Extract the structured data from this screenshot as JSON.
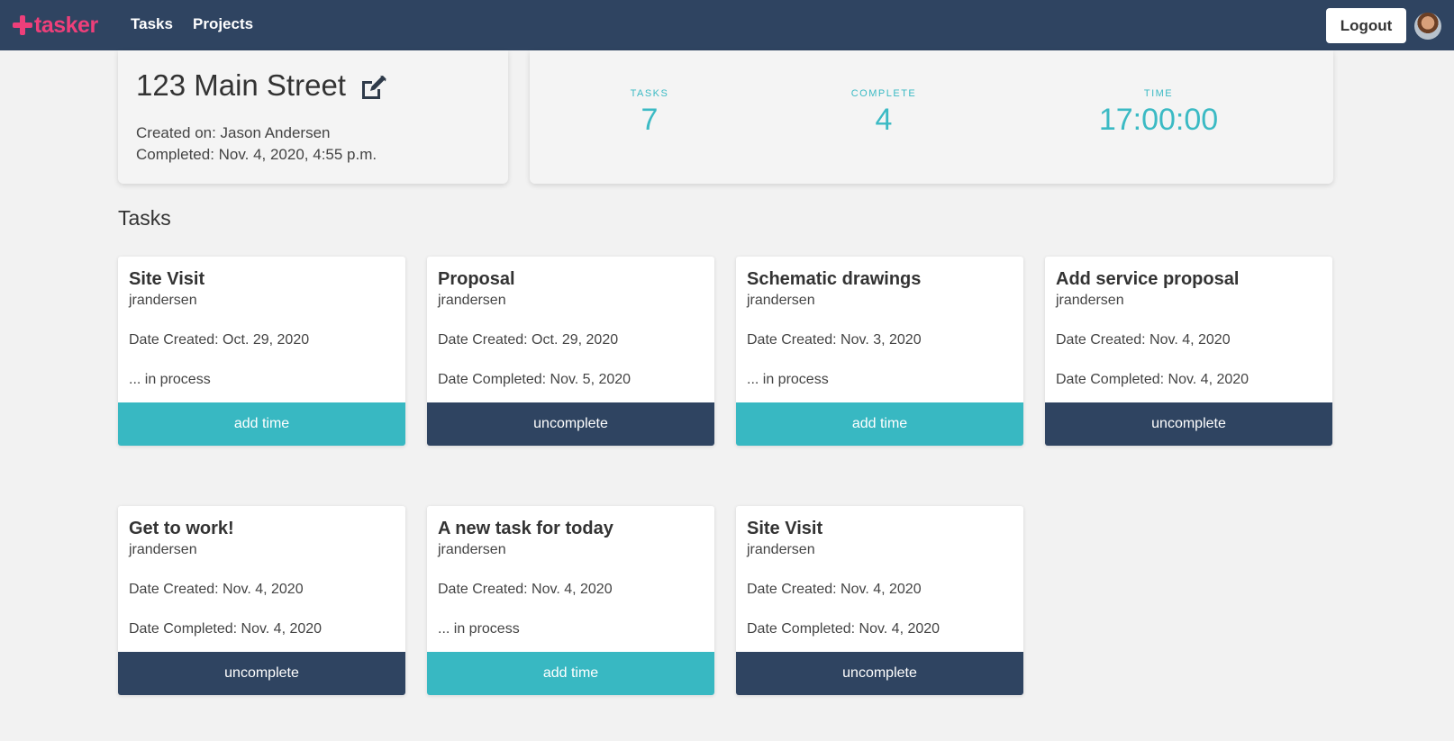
{
  "nav": {
    "brand": "tasker",
    "links": [
      {
        "label": "Tasks"
      },
      {
        "label": "Projects"
      }
    ],
    "logout_label": "Logout"
  },
  "project": {
    "title": "123 Main Street",
    "created_on": "Created on: Jason Andersen",
    "completed": "Completed: Nov. 4, 2020, 4:55 p.m."
  },
  "stats": {
    "tasks_label": "TASKS",
    "tasks_value": "7",
    "complete_label": "COMPLETE",
    "complete_value": "4",
    "time_label": "TIME",
    "time_value": "17:00:00"
  },
  "section_title": "Tasks",
  "colors": {
    "navbar": "#2f4461",
    "brand": "#ee3f7a",
    "accent_teal": "#38b8c2",
    "button_navy": "#2f4461"
  },
  "tasks": [
    {
      "title": "Site Visit",
      "user": "jrandersen",
      "created": "Date Created: Oct. 29, 2020",
      "status": "... in process",
      "action": "add time",
      "style": "teal"
    },
    {
      "title": "Proposal",
      "user": "jrandersen",
      "created": "Date Created: Oct. 29, 2020",
      "status": "Date Completed: Nov. 5, 2020",
      "action": "uncomplete",
      "style": "navy"
    },
    {
      "title": "Schematic drawings",
      "user": "jrandersen",
      "created": "Date Created: Nov. 3, 2020",
      "status": "... in process",
      "action": "add time",
      "style": "teal"
    },
    {
      "title": "Add service proposal",
      "user": "jrandersen",
      "created": "Date Created: Nov. 4, 2020",
      "status": "Date Completed: Nov. 4, 2020",
      "action": "uncomplete",
      "style": "navy"
    },
    {
      "title": "Get to work!",
      "user": "jrandersen",
      "created": "Date Created: Nov. 4, 2020",
      "status": "Date Completed: Nov. 4, 2020",
      "action": "uncomplete",
      "style": "navy"
    },
    {
      "title": "A new task for today",
      "user": "jrandersen",
      "created": "Date Created: Nov. 4, 2020",
      "status": "... in process",
      "action": "add time",
      "style": "teal"
    },
    {
      "title": "Site Visit",
      "user": "jrandersen",
      "created": "Date Created: Nov. 4, 2020",
      "status": "Date Completed: Nov. 4, 2020",
      "action": "uncomplete",
      "style": "navy"
    }
  ]
}
